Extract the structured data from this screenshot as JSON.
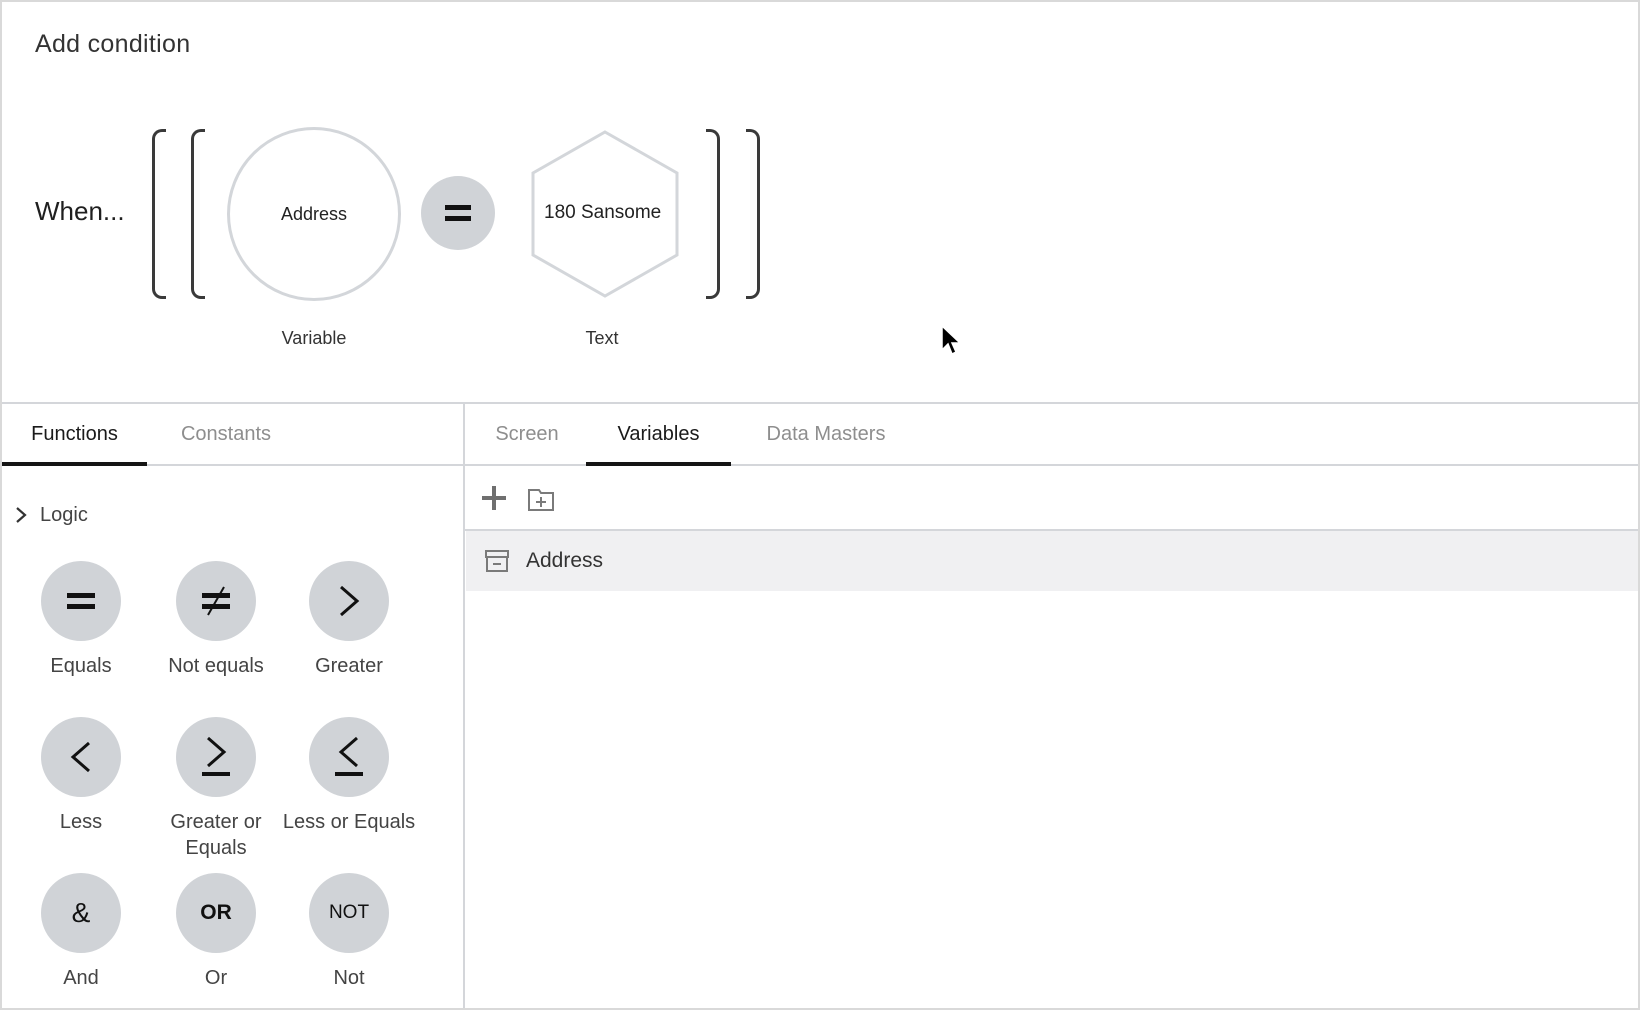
{
  "dialog": {
    "title": "Add condition"
  },
  "condition": {
    "prefix": "When...",
    "left_operand": {
      "value": "Address",
      "type_label": "Variable",
      "shape": "circle"
    },
    "operator": {
      "symbol": "=",
      "icon": "equals-icon"
    },
    "right_operand": {
      "value": "180 Sansome",
      "type_label": "Text",
      "shape": "hexagon"
    }
  },
  "left_panel": {
    "tabs": [
      {
        "label": "Functions",
        "active": true
      },
      {
        "label": "Constants",
        "active": false
      }
    ],
    "section": {
      "label": "Logic",
      "expanded": false,
      "icon": "chevron-right-icon"
    },
    "functions": [
      {
        "label": "Equals",
        "symbol": "=",
        "icon": "equals-icon"
      },
      {
        "label": "Not equals",
        "symbol": "≠",
        "icon": "not-equals-icon"
      },
      {
        "label": "Greater",
        "symbol": ">",
        "icon": "greater-than-icon"
      },
      {
        "label": "Less",
        "symbol": "<",
        "icon": "less-than-icon"
      },
      {
        "label": "Greater or Equals",
        "symbol": "≥",
        "icon": "greater-or-equal-icon"
      },
      {
        "label": "Less or Equals",
        "symbol": "≤",
        "icon": "less-or-equal-icon"
      },
      {
        "label": "And",
        "symbol": "&",
        "icon": "and-icon"
      },
      {
        "label": "Or",
        "symbol": "OR",
        "icon": "or-icon"
      },
      {
        "label": "Not",
        "symbol": "NOT",
        "icon": "not-icon"
      }
    ]
  },
  "right_panel": {
    "tabs": [
      {
        "label": "Screen",
        "active": false
      },
      {
        "label": "Variables",
        "active": true
      },
      {
        "label": "Data Masters",
        "active": false
      }
    ],
    "toolbar": {
      "add_icon": "plus-icon",
      "add_folder_icon": "add-folder-icon"
    },
    "variables": [
      {
        "name": "Address",
        "icon": "variable-box-icon",
        "selected": true
      }
    ]
  },
  "colors": {
    "operator_fill": "#d0d3d7",
    "operand_stroke": "#d3d6da",
    "selected_row": "#f0f0f2",
    "active_tab_underline": "#151515",
    "divider": "#d4d6da"
  }
}
